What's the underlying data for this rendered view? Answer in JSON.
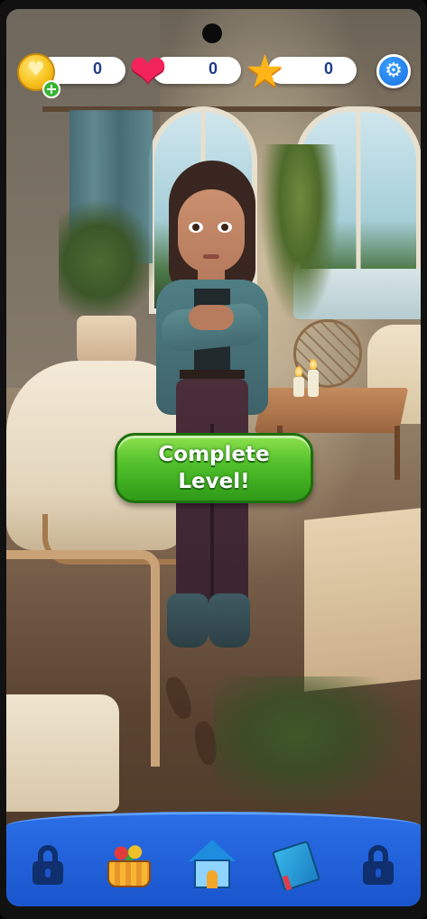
{
  "hud": {
    "coins": "0",
    "hearts": "0",
    "stars": "0",
    "coin_icon": "coin-icon",
    "add_coins_icon": "plus-icon",
    "heart_icon": "heart-icon",
    "star_icon": "star-icon",
    "settings_icon": "gear-icon"
  },
  "main": {
    "complete_line1": "Complete",
    "complete_line2": "Level!"
  },
  "bottom_nav": [
    {
      "icon": "lock-icon",
      "locked": true
    },
    {
      "icon": "shop-basket-icon",
      "locked": false
    },
    {
      "icon": "house-icon",
      "locked": false
    },
    {
      "icon": "storybook-icon",
      "locked": false
    },
    {
      "icon": "lock-icon",
      "locked": true
    }
  ],
  "colors": {
    "accent_blue": "#1a55cc",
    "button_green": "#4fbf2a",
    "counter_text": "#1f3b86"
  }
}
